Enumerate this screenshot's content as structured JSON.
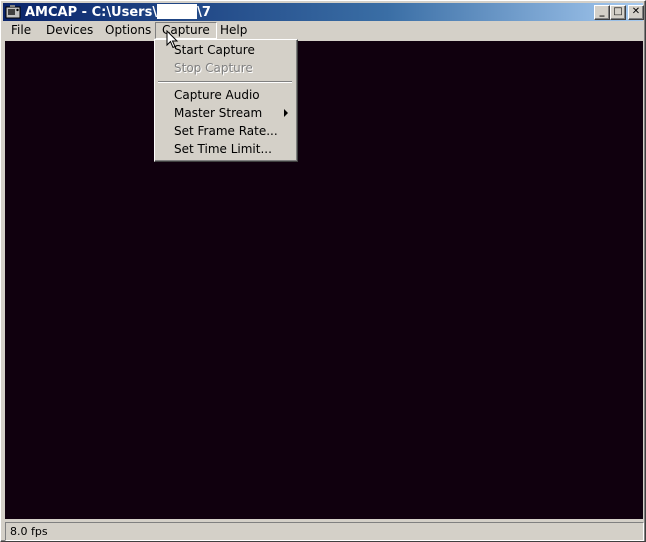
{
  "window": {
    "title_prefix": "AMCAP - C:\\Users\\",
    "title_suffix": "\\7",
    "minimize_glyph": "_",
    "maximize_glyph": "□",
    "close_glyph": "✕"
  },
  "menubar": {
    "items": [
      {
        "label": "File"
      },
      {
        "label": "Devices"
      },
      {
        "label": "Options"
      },
      {
        "label": "Capture"
      },
      {
        "label": "Help"
      }
    ]
  },
  "capture_menu": {
    "items": [
      {
        "label": "Start Capture",
        "enabled": true
      },
      {
        "label": "Stop Capture",
        "enabled": false
      },
      {
        "label": "Capture Audio",
        "enabled": true
      },
      {
        "label": "Master Stream",
        "enabled": true,
        "submenu": true
      },
      {
        "label": "Set Frame Rate...",
        "enabled": true
      },
      {
        "label": "Set Time Limit...",
        "enabled": true
      }
    ]
  },
  "statusbar": {
    "fps": "8.0 fps"
  },
  "colors": {
    "titlebar_start": "#0a246a",
    "video_background": "#10000e",
    "chrome": "#d4d0c8"
  }
}
